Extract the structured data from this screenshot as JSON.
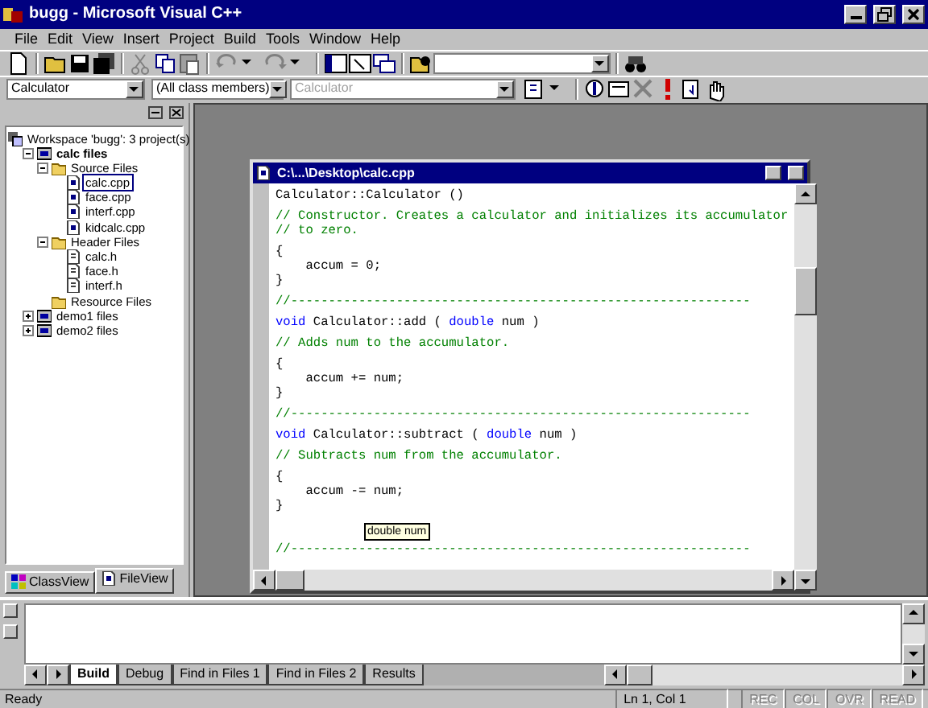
{
  "window": {
    "title": "bugg - Microsoft Visual C++"
  },
  "menu": [
    "File",
    "Edit",
    "View",
    "Insert",
    "Project",
    "Build",
    "Tools",
    "Window",
    "Help"
  ],
  "wizard_bar": [
    {
      "text": "Calculator",
      "disabled": false
    },
    {
      "text": "(All class members)",
      "disabled": false
    },
    {
      "text": "Calculator",
      "disabled": true
    }
  ],
  "workspace": {
    "tree": [
      {
        "label": "Workspace 'bugg': 3 project(s)",
        "kind": "workspace",
        "bold": false,
        "selected": false,
        "children": [
          {
            "label": "calc files",
            "kind": "project",
            "bold": true,
            "selected": false,
            "expanded": true,
            "children": [
              {
                "label": "Source Files",
                "kind": "folder",
                "bold": false,
                "selected": false,
                "expanded": true,
                "children": [
                  {
                    "label": "calc.cpp",
                    "kind": "file",
                    "bold": false,
                    "selected": true
                  },
                  {
                    "label": "face.cpp",
                    "kind": "file",
                    "bold": false,
                    "selected": false
                  },
                  {
                    "label": "interf.cpp",
                    "kind": "file",
                    "bold": false,
                    "selected": false
                  },
                  {
                    "label": "kidcalc.cpp",
                    "kind": "file",
                    "bold": false,
                    "selected": false
                  }
                ]
              },
              {
                "label": "Header Files",
                "kind": "folder",
                "bold": false,
                "selected": false,
                "expanded": true,
                "children": [
                  {
                    "label": "calc.h",
                    "kind": "header",
                    "bold": false,
                    "selected": false
                  },
                  {
                    "label": "face.h",
                    "kind": "header",
                    "bold": false,
                    "selected": false
                  },
                  {
                    "label": "interf.h",
                    "kind": "header",
                    "bold": false,
                    "selected": false
                  }
                ]
              },
              {
                "label": "Resource Files",
                "kind": "folder",
                "bold": false,
                "selected": false
              }
            ]
          },
          {
            "label": "demo1 files",
            "kind": "project",
            "bold": false,
            "selected": false,
            "expanded": false
          },
          {
            "label": "demo2 files",
            "kind": "project",
            "bold": false,
            "selected": false,
            "expanded": false
          }
        ]
      }
    ],
    "tabs": [
      {
        "label": "ClassView",
        "kind": "class",
        "selected": false
      },
      {
        "label": "FileView",
        "kind": "file",
        "selected": true
      }
    ]
  },
  "editor": {
    "title": "C:\\...\\Desktop\\calc.cpp",
    "blocks": [
      [
        [
          {
            "kind": "code",
            "text": "Calculator::Calculator ()"
          }
        ]
      ],
      [
        [
          {
            "kind": "comment",
            "text": "// Constructor. Creates a calculator and initializes its accumulator"
          }
        ],
        [
          {
            "kind": "comment",
            "text": "// to zero."
          }
        ]
      ],
      [
        [
          {
            "kind": "code",
            "text": "{"
          }
        ],
        [
          {
            "kind": "code",
            "text": "    accum = 0;"
          }
        ],
        [
          {
            "kind": "code",
            "text": "}"
          }
        ]
      ],
      [
        [
          {
            "kind": "comment",
            "text": "//-------------------------------------------------------------"
          }
        ]
      ],
      [
        [
          {
            "kind": "keyword",
            "text": "void"
          },
          {
            "kind": "code",
            "text": " Calculator::add ( "
          },
          {
            "kind": "keyword",
            "text": "double"
          },
          {
            "kind": "code",
            "text": " num )"
          }
        ]
      ],
      [
        [
          {
            "kind": "comment",
            "text": "// Adds num to the accumulator."
          }
        ]
      ],
      [
        [
          {
            "kind": "code",
            "text": "{"
          }
        ],
        [
          {
            "kind": "code",
            "text": "    accum += num;"
          }
        ],
        [
          {
            "kind": "code",
            "text": "}"
          }
        ]
      ],
      [
        [
          {
            "kind": "comment",
            "text": "//-------------------------------------------------------------"
          }
        ]
      ],
      [
        [
          {
            "kind": "keyword",
            "text": "void"
          },
          {
            "kind": "code",
            "text": " Calculator::subtract ( "
          },
          {
            "kind": "keyword",
            "text": "double"
          },
          {
            "kind": "code",
            "text": " num )"
          }
        ]
      ],
      [
        [
          {
            "kind": "comment",
            "text": "// Subtracts num from the accumulator."
          }
        ]
      ],
      [
        [
          {
            "kind": "code",
            "text": "{"
          }
        ],
        [
          {
            "kind": "code",
            "text": "    accum -= num;"
          }
        ],
        [
          {
            "kind": "code",
            "text": "}"
          }
        ]
      ],
      [
        [
          {
            "kind": "comment",
            "text": "//-------------------------------------------------------------"
          }
        ]
      ]
    ],
    "tooltip": "double num"
  },
  "output": {
    "tabs": [
      {
        "label": "Build",
        "selected": true
      },
      {
        "label": "Debug",
        "selected": false
      },
      {
        "label": "Find in Files 1",
        "selected": false
      },
      {
        "label": "Find in Files 2",
        "selected": false
      },
      {
        "label": "Results",
        "selected": false
      }
    ]
  },
  "status_bar": {
    "message": "Ready",
    "position": "Ln 1, Col 1",
    "indicators": [
      {
        "text": "REC",
        "disabled": true
      },
      {
        "text": "COL",
        "disabled": true
      },
      {
        "text": "OVR",
        "disabled": true
      },
      {
        "text": "READ",
        "disabled": true
      }
    ]
  }
}
